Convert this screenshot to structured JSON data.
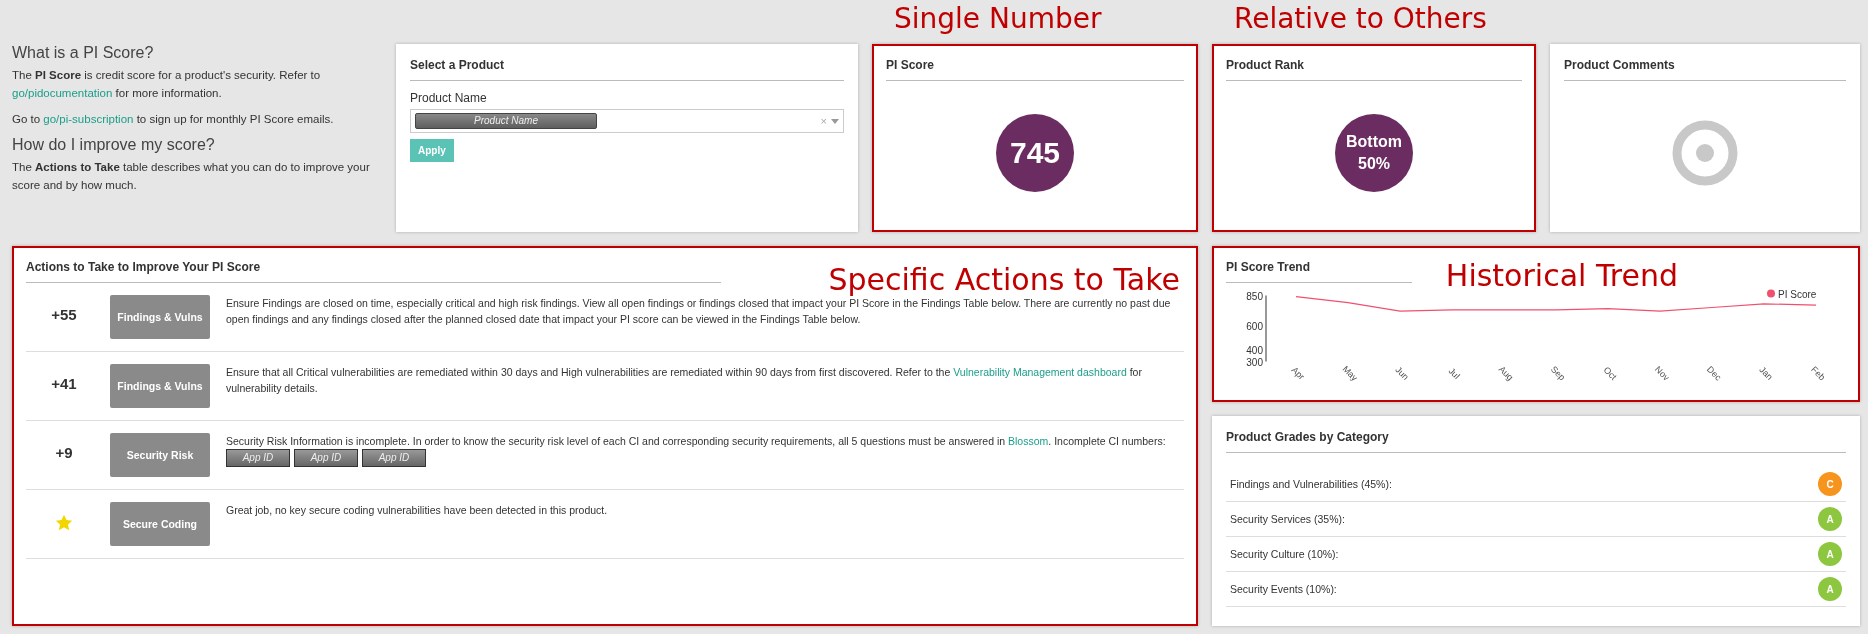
{
  "intro": {
    "sections": [
      {
        "heading": "What is a PI Score?",
        "paragraphs": [
          [
            {
              "text": "The **PI Score** is credit score for a product's security. Refer to "
            },
            {
              "link": "go/pidocumentation"
            },
            {
              "text": " for more information."
            }
          ],
          [
            {
              "text": "Go to "
            },
            {
              "link": "go/pi-subscription"
            },
            {
              "text": " to sign up for monthly PI Score emails."
            }
          ]
        ]
      },
      {
        "heading": "How do I improve my score?",
        "paragraphs": [
          [
            {
              "text": "The **Actions to Take** table describes what you can do to improve your score and by how much."
            }
          ]
        ]
      }
    ]
  },
  "select_product": {
    "title": "Select a Product",
    "field_label": "Product Name",
    "chip": "Product Name",
    "clear": "×",
    "button": "Apply"
  },
  "pi_score": {
    "title": "PI Score",
    "value": "745",
    "highlighted": true,
    "annotation": "Single Number"
  },
  "product_rank": {
    "title": "Product Rank",
    "line_1": "Bottom",
    "line_2": "50%",
    "highlighted": true,
    "annotation": "Relative to Others"
  },
  "product_comments": {
    "title": "Product Comments",
    "loading": true
  },
  "actions": {
    "title": "Actions to Take to Improve Your PI Score",
    "highlighted": true,
    "annotation": "Specific Actions to Take",
    "rows": [
      {
        "kind": "points",
        "points": "+55",
        "category": "Findings & Vulns",
        "segments": [
          {
            "text": "Ensure Findings are closed on time, especially critical and high risk findings. View all open findings or findings closed that impact your PI Score in the Findings Table below. There are currently no past due open findings and any findings closed after the planned closed date that impact your PI score can be viewed in the Findings Table below."
          }
        ]
      },
      {
        "kind": "points",
        "points": "+41",
        "category": "Findings & Vulns",
        "segments": [
          {
            "text": "Ensure that all Critical vulnerabilities are remediated within 30 days and High vulnerabilities are remediated within 90 days from first discovered. Refer to the "
          },
          {
            "link": "Vulnerability Management dashboard"
          },
          {
            "text": " for vulnerability details."
          }
        ]
      },
      {
        "kind": "points",
        "points": "+9",
        "category": "Security Risk",
        "segments": [
          {
            "text": "Security Risk Information is incomplete. In order to know the security risk level of each CI and corresponding security requirements, all 5 questions must be answered in "
          },
          {
            "link": "Blossom"
          },
          {
            "text": ". Incomplete CI numbers:"
          }
        ],
        "app_ids": [
          "App ID",
          "App ID",
          "App ID"
        ]
      },
      {
        "kind": "star",
        "category": "Secure Coding",
        "segments": [
          {
            "text": "Great job, no key secure coding vulnerabilities have been detected in this product."
          }
        ]
      }
    ]
  },
  "trend": {
    "title": "PI Score Trend",
    "highlighted": true,
    "annotation": "Historical Trend",
    "chart_data": {
      "type": "line",
      "categories": [
        "Apr",
        "May",
        "Jun",
        "Jul",
        "Aug",
        "Sep",
        "Oct",
        "Nov",
        "Dec",
        "Jan",
        "Feb"
      ],
      "ylim": [
        300,
        850
      ],
      "yticks": [
        300,
        400,
        600,
        850
      ],
      "series": [
        {
          "name": "PI Score",
          "color": "#f0506e",
          "values": [
            840,
            790,
            720,
            730,
            730,
            730,
            740,
            720,
            750,
            780,
            770
          ]
        }
      ]
    }
  },
  "grades": {
    "title": "Product Grades by Category",
    "rows": [
      {
        "label": "Findings and Vulnerabilities (45%):",
        "grade": "C",
        "color": "#f7941d"
      },
      {
        "label": "Security Services (35%):",
        "grade": "A",
        "color": "#8dc63f"
      },
      {
        "label": "Security Culture (10%):",
        "grade": "A",
        "color": "#8dc63f"
      },
      {
        "label": "Security Events (10%):",
        "grade": "A",
        "color": "#8dc63f"
      }
    ]
  }
}
